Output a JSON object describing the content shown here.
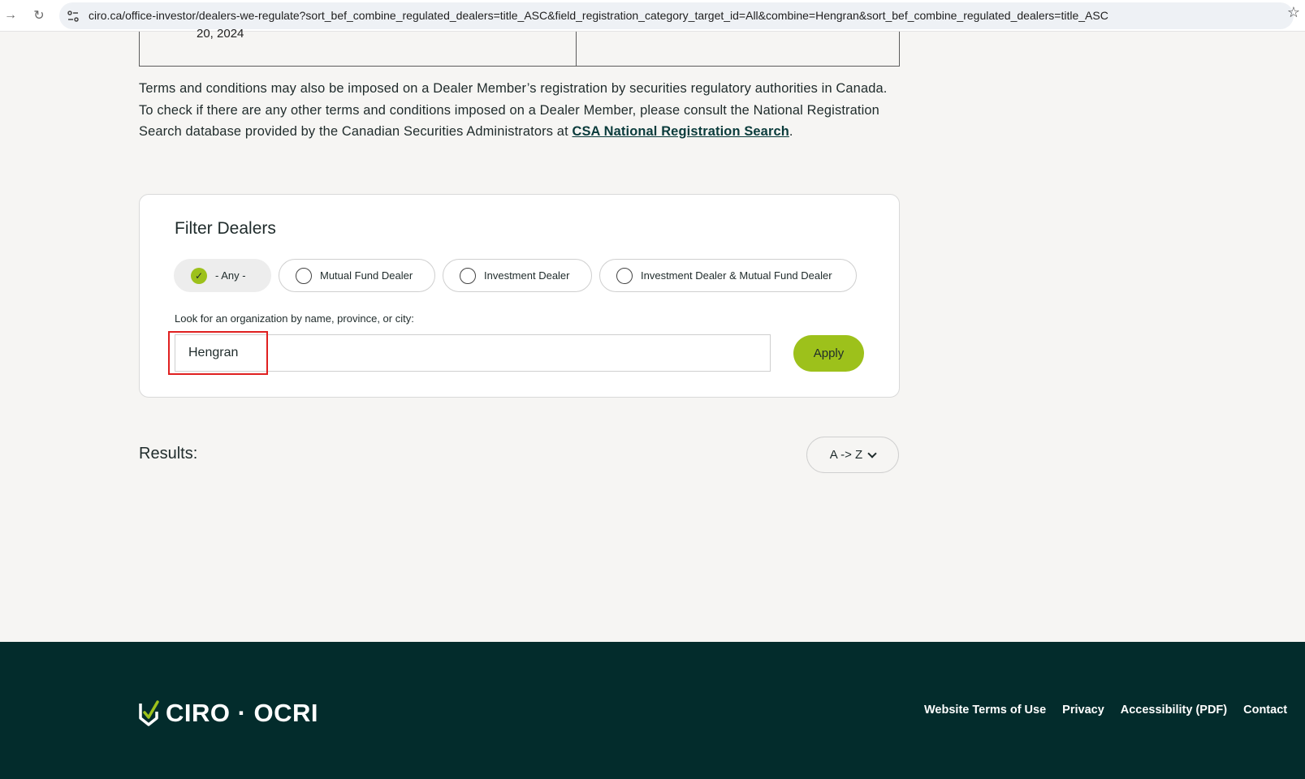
{
  "browser": {
    "url": "ciro.ca/office-investor/dealers-we-regulate?sort_bef_combine_regulated_dealers=title_ASC&field_registration_category_target_id=All&combine=Hengran&sort_bef_combine_regulated_dealers=title_ASC"
  },
  "table_fragment": {
    "cell_text": "20, 2024"
  },
  "terms": {
    "text_before_link": "Terms and conditions may also be imposed on a Dealer Member’s registration by securities regulatory authorities in Canada. To check if there are any other terms and conditions imposed on a Dealer Member, please consult the National Registration Search database provided by the Canadian Securities Administrators at ",
    "link_text": "CSA National Registration Search",
    "text_after_link": "."
  },
  "filter": {
    "title": "Filter Dealers",
    "options": [
      {
        "label": "- Any -",
        "selected": true
      },
      {
        "label": "Mutual Fund Dealer",
        "selected": false
      },
      {
        "label": "Investment Dealer",
        "selected": false
      },
      {
        "label": "Investment Dealer & Mutual Fund Dealer",
        "selected": false
      }
    ],
    "search_label": "Look for an organization by name, province, or city:",
    "search_value": "Hengran",
    "apply_label": "Apply"
  },
  "results": {
    "label": "Results:",
    "sort_value": "A -> Z"
  },
  "footer": {
    "logo_text": "CIRO · OCRI",
    "links": [
      "Website Terms of Use",
      "Privacy",
      "Accessibility (PDF)",
      "Contact"
    ]
  },
  "colors": {
    "accent_green": "#9dc11b",
    "footer_bg": "#032c2c",
    "highlight_red": "#e02020"
  }
}
